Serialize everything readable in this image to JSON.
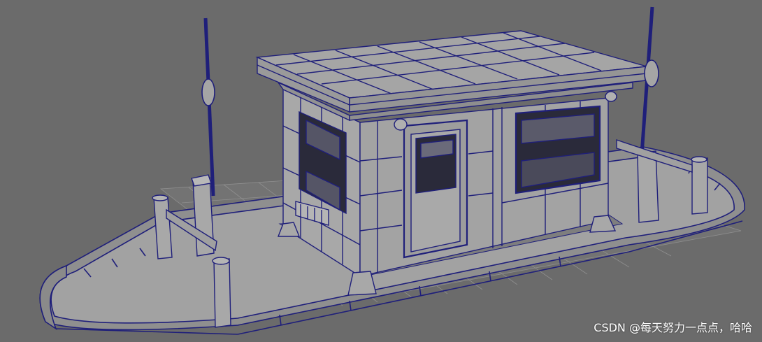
{
  "viewport": {
    "background": "#6b6b6b",
    "wire_color": "#1f1f7a",
    "grid_color": "#8c8c8c",
    "surface_color": "#9a9a9a"
  },
  "watermark": {
    "text": "CSDN @每天努力一点点，哈哈"
  }
}
